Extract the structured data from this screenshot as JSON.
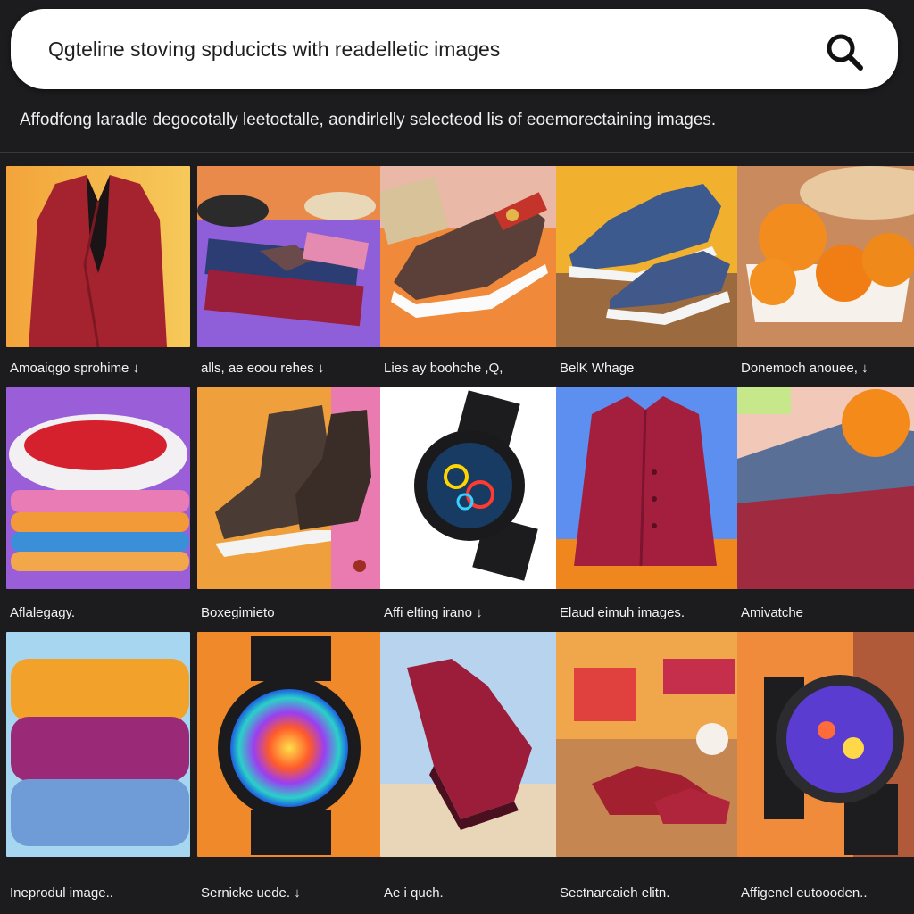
{
  "search": {
    "value": "Qgteline stoving spducicts with readelletic images"
  },
  "subtitle": "Affodfong laradle degocotally leetoctalle, aondirlelly selecteod lis of eoemorectaining images.",
  "products": [
    {
      "caption": "Amoaiqgo sprohime ↓",
      "icon": "red-blazer"
    },
    {
      "caption": "alls, ae eoou rehes ↓",
      "icon": "folded-sweaters-shoes"
    },
    {
      "caption": "Lies ay boohche ,Q,",
      "icon": "sneaker"
    },
    {
      "caption": "BelK  Whage",
      "icon": "blue-sneakers"
    },
    {
      "caption": "Donemoch anouee, ↓",
      "icon": "orange-bowl"
    },
    {
      "caption": "Aflalegagy.",
      "icon": "berry-plate-towels"
    },
    {
      "caption": "Boxegimieto",
      "icon": "leather-boots"
    },
    {
      "caption": "Affi elting irano ↓",
      "icon": "smartwatch"
    },
    {
      "caption": "Elaud eimuh images.",
      "icon": "red-coat"
    },
    {
      "caption": "Amivatche",
      "icon": "knit-scarf-orange"
    },
    {
      "caption": "Ineprodul image..",
      "icon": "folded-towels"
    },
    {
      "caption": "Sernicke uede. ↓",
      "icon": "rainbow-watch"
    },
    {
      "caption": "Ae i quch.",
      "icon": "red-knit-sneaker"
    },
    {
      "caption": "Sectnarcaieh elitn.",
      "icon": "gifts-shoes"
    },
    {
      "caption": "Affigenel eutoooden..",
      "icon": "smartwatch-dark"
    }
  ],
  "colors": {
    "background": "#1c1b1d",
    "search_bg": "#ffffff",
    "text": "#f0f0f0"
  }
}
